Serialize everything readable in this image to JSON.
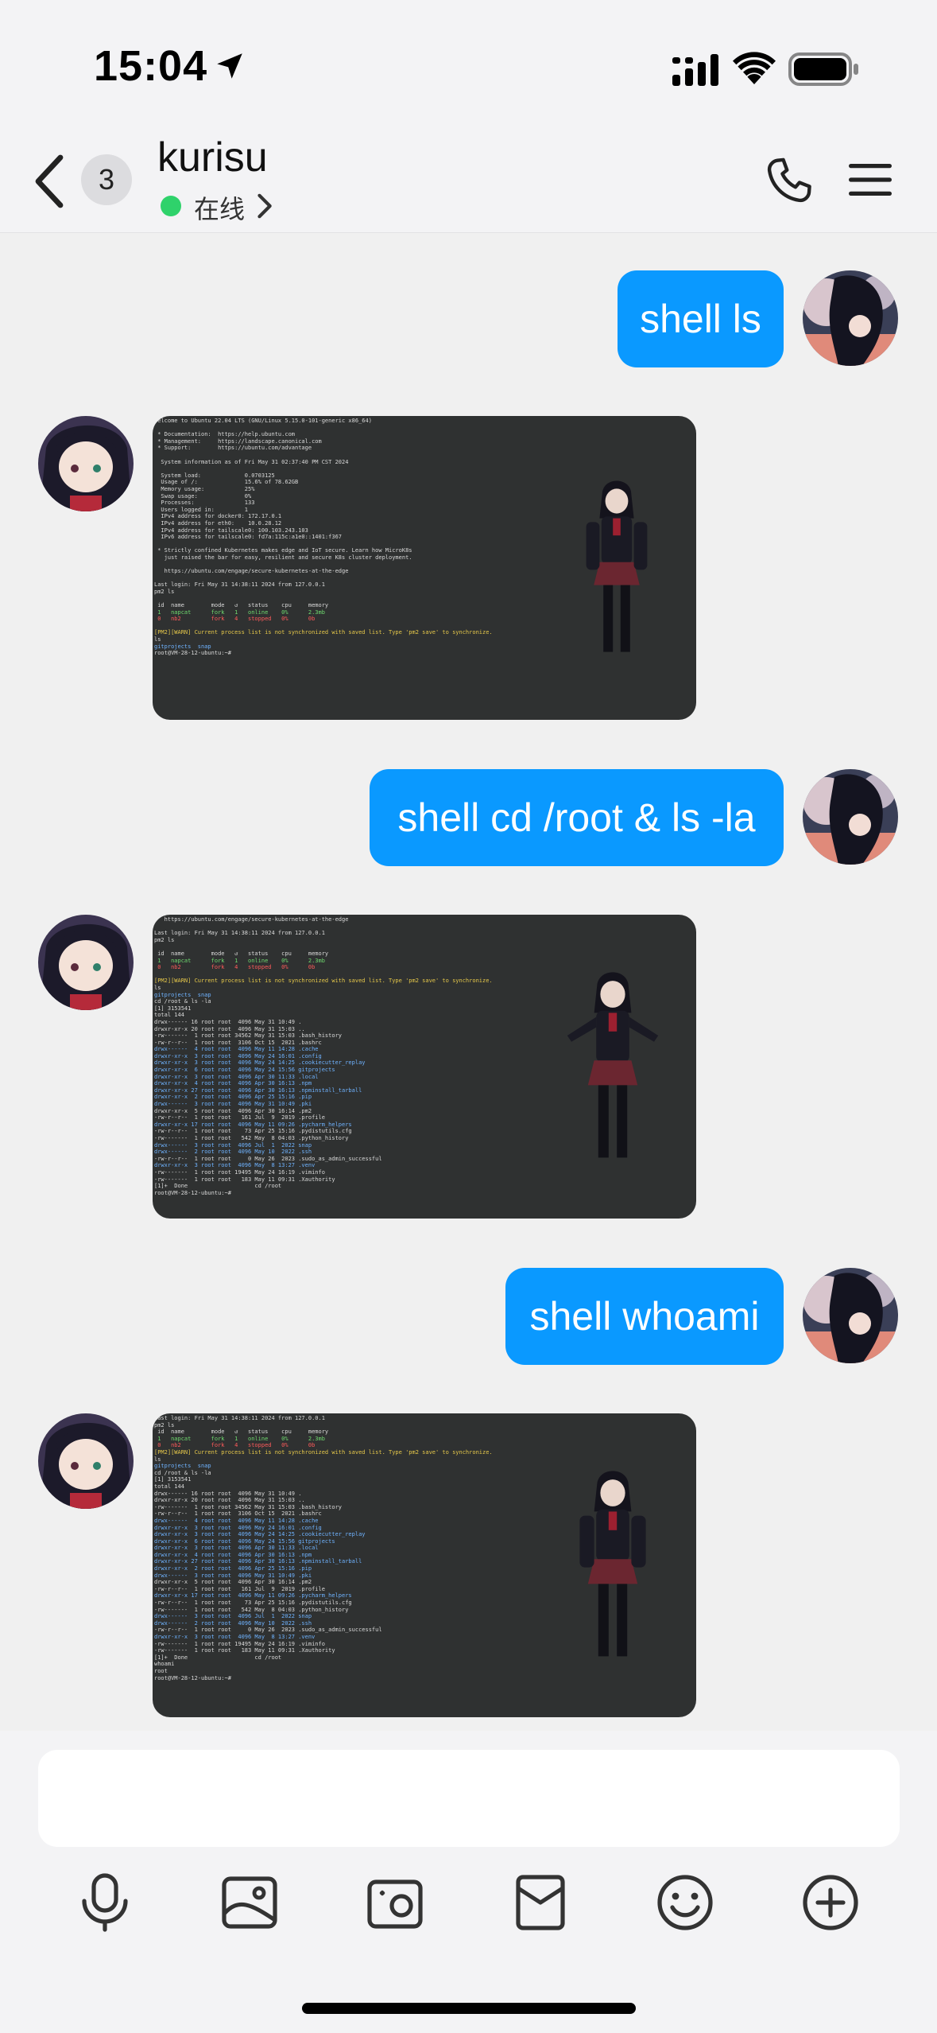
{
  "status_bar": {
    "time": "15:04",
    "icons": [
      "location-arrow-icon",
      "cellular-signal-icon",
      "wifi-icon",
      "battery-icon"
    ]
  },
  "header": {
    "unread_count": "3",
    "contact_name": "kurisu",
    "status_text": "在线",
    "status_color": "#2fd26b",
    "icons": [
      "back-chevron-icon",
      "phone-icon",
      "menu-icon"
    ]
  },
  "messages": [
    {
      "from": "me",
      "type": "text",
      "text": "shell ls"
    },
    {
      "from": "bot",
      "type": "image",
      "lines": [
        "Welcome to Ubuntu 22.04 LTS (GNU/Linux 5.15.0-101-generic x86_64)",
        "",
        " * Documentation:  https://help.ubuntu.com",
        " * Management:     https://landscape.canonical.com",
        " * Support:        https://ubuntu.com/advantage",
        "",
        "  System information as of Fri May 31 02:37:40 PM CST 2024",
        "",
        "  System load:             0.0703125",
        "  Usage of /:              15.6% of 78.62GB",
        "  Memory usage:            25%",
        "  Swap usage:              0%",
        "  Processes:               133",
        "  Users logged in:         1",
        "  IPv4 address for docker0: 172.17.0.1",
        "  IPv4 address for eth0:    10.0.28.12",
        "  IPv4 address for tailscale0: 100.103.243.103",
        "  IPv6 address for tailscale0: fd7a:115c:a1e0::1401:f367",
        "",
        " * Strictly confined Kubernetes makes edge and IoT secure. Learn how MicroK8s",
        "   just raised the bar for easy, resilient and secure K8s cluster deployment.",
        "",
        "   https://ubuntu.com/engage/secure-kubernetes-at-the-edge",
        "",
        "Last login: Fri May 31 14:38:11 2024 from 127.0.0.1",
        "pm2 ls",
        "",
        " id  name        mode   ↺   status    cpu     memory",
        " 1   napcat      fork   1   online    0%      2.3mb",
        " 0   nb2         fork   4   stopped   0%      0b",
        "",
        "[PM2][WARN] Current process list is not synchronized with saved list. Type 'pm2 save' to synchronize.",
        "ls",
        "gitprojects  snap",
        "root@VM-28-12-ubuntu:~# "
      ]
    },
    {
      "from": "me",
      "type": "text",
      "text": "shell cd /root & ls -la"
    },
    {
      "from": "bot",
      "type": "image",
      "lines": [
        "   https://ubuntu.com/engage/secure-kubernetes-at-the-edge",
        "",
        "Last login: Fri May 31 14:38:11 2024 from 127.0.0.1",
        "pm2 ls",
        "",
        " id  name        mode   ↺   status    cpu     memory",
        " 1   napcat      fork   1   online    0%      2.3mb",
        " 0   nb2         fork   4   stopped   0%      0b",
        "",
        "[PM2][WARN] Current process list is not synchronized with saved list. Type 'pm2 save' to synchronize.",
        "ls",
        "gitprojects  snap",
        "cd /root & ls -la",
        "[1] 3153541",
        "total 144",
        "drwx------ 16 root root  4096 May 31 10:49 .",
        "drwxr-xr-x 20 root root  4096 May 31 15:03 ..",
        "-rw-------  1 root root 34562 May 31 15:03 .bash_history",
        "-rw-r--r--  1 root root  3106 Oct 15  2021 .bashrc",
        "drwx------  4 root root  4096 May 11 14:28 .cache",
        "drwxr-xr-x  3 root root  4096 May 24 16:01 .config",
        "drwxr-xr-x  3 root root  4096 May 24 14:25 .cookiecutter_replay",
        "drwxr-xr-x  6 root root  4096 May 24 15:56 gitprojects",
        "drwxr-xr-x  3 root root  4096 Apr 30 11:33 .local",
        "drwxr-xr-x  4 root root  4096 Apr 30 16:13 .npm",
        "drwxr-xr-x 27 root root  4096 Apr 30 16:13 .npminstall_tarball",
        "drwxr-xr-x  2 root root  4096 Apr 25 15:16 .pip",
        "drwx------  3 root root  4096 May 31 10:49 .pki",
        "drwxr-xr-x  5 root root  4096 Apr 30 16:14 .pm2",
        "-rw-r--r--  1 root root   161 Jul  9  2019 .profile",
        "drwxr-xr-x 17 root root  4096 May 11 09:26 .pycharm_helpers",
        "-rw-r--r--  1 root root    73 Apr 25 15:16 .pydistutils.cfg",
        "-rw-------  1 root root   542 May  8 04:03 .python_history",
        "drwx------  3 root root  4096 Jul  1  2022 snap",
        "drwx------  2 root root  4096 May 10  2022 .ssh",
        "-rw-r--r--  1 root root     0 May 26  2023 .sudo_as_admin_successful",
        "drwxr-xr-x  3 root root  4096 May  8 13:27 .venv",
        "-rw-------  1 root root 19495 May 24 16:19 .viminfo",
        "-rw-------  1 root root   183 May 11 09:31 .Xauthority",
        "[1]+  Done                    cd /root",
        "root@VM-28-12-ubuntu:~# "
      ]
    },
    {
      "from": "me",
      "type": "text",
      "text": "shell whoami"
    },
    {
      "from": "bot",
      "type": "image",
      "lines": [
        "Last login: Fri May 31 14:38:11 2024 from 127.0.0.1",
        "pm2 ls",
        " id  name        mode   ↺   status    cpu     memory",
        " 1   napcat      fork   1   online    0%      2.3mb",
        " 0   nb2         fork   4   stopped   0%      0b",
        "[PM2][WARN] Current process list is not synchronized with saved list. Type 'pm2 save' to synchronize.",
        "ls",
        "gitprojects  snap",
        "cd /root & ls -la",
        "[1] 3153541",
        "total 144",
        "drwx------ 16 root root  4096 May 31 10:49 .",
        "drwxr-xr-x 20 root root  4096 May 31 15:03 ..",
        "-rw-------  1 root root 34562 May 31 15:03 .bash_history",
        "-rw-r--r--  1 root root  3106 Oct 15  2021 .bashrc",
        "drwx------  4 root root  4096 May 11 14:28 .cache",
        "drwxr-xr-x  3 root root  4096 May 24 16:01 .config",
        "drwxr-xr-x  3 root root  4096 May 24 14:25 .cookiecutter_replay",
        "drwxr-xr-x  6 root root  4096 May 24 15:56 gitprojects",
        "drwxr-xr-x  3 root root  4096 Apr 30 11:33 .local",
        "drwxr-xr-x  4 root root  4096 Apr 30 16:13 .npm",
        "drwxr-xr-x 27 root root  4096 Apr 30 16:13 .npminstall_tarball",
        "drwxr-xr-x  2 root root  4096 Apr 25 15:16 .pip",
        "drwx------  3 root root  4096 May 31 10:49 .pki",
        "drwxr-xr-x  5 root root  4096 Apr 30 16:14 .pm2",
        "-rw-r--r--  1 root root   161 Jul  9  2019 .profile",
        "drwxr-xr-x 17 root root  4096 May 11 09:26 .pycharm_helpers",
        "-rw-r--r--  1 root root    73 Apr 25 15:16 .pydistutils.cfg",
        "-rw-------  1 root root   542 May  8 04:03 .python_history",
        "drwx------  3 root root  4096 Jul  1  2022 snap",
        "drwx------  2 root root  4096 May 10  2022 .ssh",
        "-rw-r--r--  1 root root     0 May 26  2023 .sudo_as_admin_successful",
        "drwxr-xr-x  3 root root  4096 May  8 13:27 .venv",
        "-rw-------  1 root root 19495 May 24 16:19 .viminfo",
        "-rw-------  1 root root   183 May 11 09:31 .Xauthority",
        "[1]+  Done                    cd /root",
        "whoami",
        "root",
        "root@VM-28-12-ubuntu:~# "
      ]
    }
  ],
  "composer": {
    "input_value": "",
    "tools": [
      "microphone-icon",
      "image-icon",
      "camera-icon",
      "red-packet-icon",
      "emoji-icon",
      "plus-icon"
    ]
  },
  "colors": {
    "bubble": "#0a99ff",
    "chat_background": "#f0f0f0",
    "terminal_background": "#2f3131"
  }
}
